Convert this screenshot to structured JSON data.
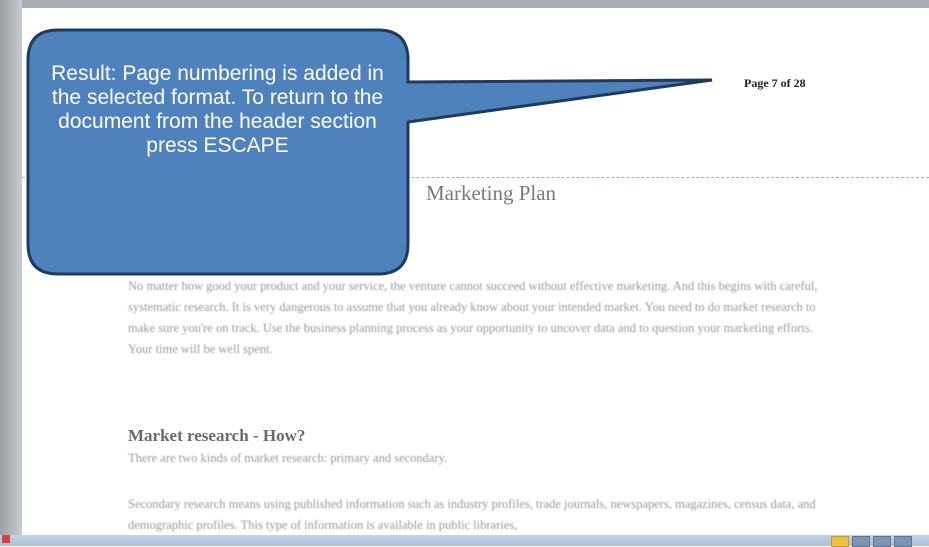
{
  "header": {
    "page_number": "Page 7 of 28"
  },
  "document": {
    "title": "Marketing Plan",
    "paragraphs": [
      "No matter how good your product and your service, the venture cannot succeed without effective marketing. And this begins with careful, systematic research. It is very dangerous to assume that you already know about your intended market. You need to do market research to make sure you're on track. Use the business planning process as your opportunity to uncover data and to question your marketing efforts. Your time will be well spent."
    ],
    "section_heading": "Market research - How?",
    "section_intro": "There are two kinds of market research: primary and secondary.",
    "section_paragraph": "Secondary research means using published information such as industry profiles, trade journals, newspapers, magazines, census data, and demographic profiles. This type of information is available in public libraries,"
  },
  "callout": {
    "text": "Result: Page numbering is added in the selected format. To return to the document from the header section press ESCAPE",
    "fill_color": "#4f81bd",
    "border_color": "#1f3a5f"
  }
}
